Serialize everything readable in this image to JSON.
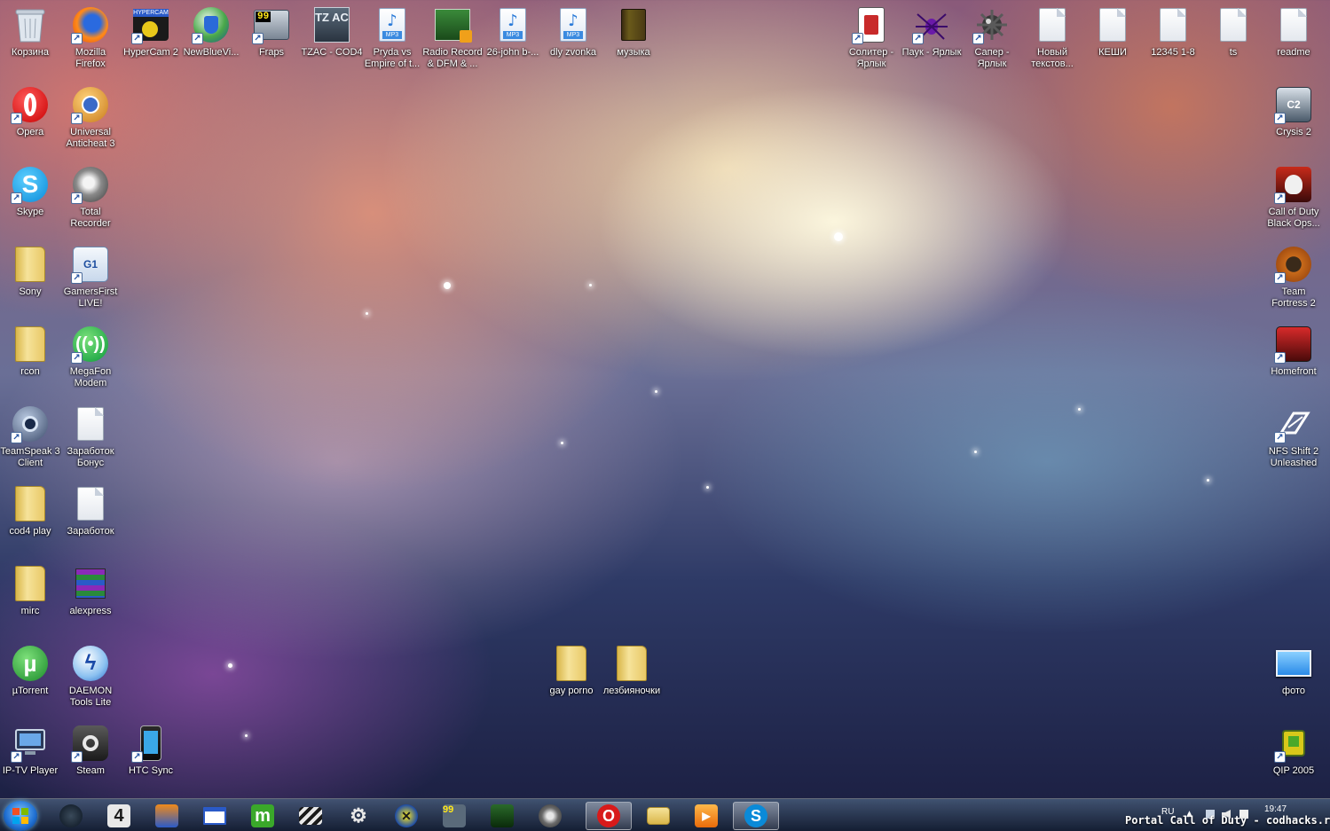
{
  "desktop": {
    "icons": [
      {
        "id": "recycle-bin",
        "label": "Корзина",
        "icon": "recycle-bin-icon"
      },
      {
        "id": "mozilla-firefox",
        "label": "Mozilla Firefox",
        "icon": "firefox-icon"
      },
      {
        "id": "hypercam",
        "label": "HyperCam 2",
        "icon": "hypercam-icon",
        "badge": "HYPERCAM"
      },
      {
        "id": "newbluevi",
        "label": "NewBlueVi...",
        "icon": "newblue-icon"
      },
      {
        "id": "fraps",
        "label": "Fraps",
        "icon": "fraps-icon",
        "badge": "99"
      },
      {
        "id": "tzac",
        "label": "TZAC - COD4",
        "icon": "tzac-icon",
        "badge": "TZ AC"
      },
      {
        "id": "pryda",
        "label": "Pryda vs Empire of t...",
        "icon": "mp3-file-icon",
        "badge": "MP3"
      },
      {
        "id": "radio-record",
        "label": "Radio Record & DFM & ...",
        "icon": "radio-record-icon"
      },
      {
        "id": "26-john",
        "label": "26-john b-...",
        "icon": "mp3-file-icon",
        "badge": "MP3"
      },
      {
        "id": "dly-zvonka",
        "label": "dly zvonka",
        "icon": "mp3-file-icon",
        "badge": "MP3"
      },
      {
        "id": "muzyka",
        "label": "музыка",
        "icon": "book-icon"
      },
      {
        "id": "solitaire",
        "label": "Солитер - Ярлык",
        "icon": "solitaire-icon"
      },
      {
        "id": "spider",
        "label": "Паук - Ярлык",
        "icon": "spider-icon"
      },
      {
        "id": "minesweeper",
        "label": "Сапер - Ярлык",
        "icon": "minesweeper-icon"
      },
      {
        "id": "new-text",
        "label": "Новый текстов...",
        "icon": "text-file-icon"
      },
      {
        "id": "keshi",
        "label": "КЕШИ",
        "icon": "text-file-icon"
      },
      {
        "id": "12345",
        "label": "12345 1-8",
        "icon": "text-file-icon"
      },
      {
        "id": "ts",
        "label": "ts",
        "icon": "text-file-icon"
      },
      {
        "id": "readme",
        "label": "readme",
        "icon": "text-file-icon"
      },
      {
        "id": "opera",
        "label": "Opera",
        "icon": "opera-icon"
      },
      {
        "id": "universal-anticheat",
        "label": "Universal Anticheat 3",
        "icon": "anticheat-icon"
      },
      {
        "id": "crysis2",
        "label": "Crysis 2",
        "icon": "crysis-icon"
      },
      {
        "id": "skype",
        "label": "Skype",
        "icon": "skype-icon"
      },
      {
        "id": "total-recorder",
        "label": "Total Recorder",
        "icon": "speaker-icon"
      },
      {
        "id": "cod-bo",
        "label": "Call of Duty Black Ops...",
        "icon": "black-ops-icon"
      },
      {
        "id": "sony",
        "label": "Sony",
        "icon": "folder-icon"
      },
      {
        "id": "gamersfirst",
        "label": "GamersFirst LIVE!",
        "icon": "gamersfirst-icon"
      },
      {
        "id": "tf2",
        "label": "Team Fortress 2",
        "icon": "tf2-icon"
      },
      {
        "id": "rcon",
        "label": "rcon",
        "icon": "folder-icon"
      },
      {
        "id": "megafon",
        "label": "MegaFon Modem",
        "icon": "megafon-icon"
      },
      {
        "id": "homefront",
        "label": "Homefront",
        "icon": "homefront-icon"
      },
      {
        "id": "teamspeak",
        "label": "TeamSpeak 3 Client",
        "icon": "teamspeak-icon"
      },
      {
        "id": "zarabotok-bonus",
        "label": "Заработок Бонус",
        "icon": "text-file-icon"
      },
      {
        "id": "nfs",
        "label": "NFS Shift 2 Unleashed",
        "icon": "nfs-icon"
      },
      {
        "id": "cod4play",
        "label": "cod4 play",
        "icon": "folder-icon"
      },
      {
        "id": "zarobotok",
        "label": "Заработок",
        "icon": "text-file-icon"
      },
      {
        "id": "mirc",
        "label": "mirc",
        "icon": "folder-icon"
      },
      {
        "id": "alexpress",
        "label": "alexpress",
        "icon": "winrar-icon"
      },
      {
        "id": "gay-porno",
        "label": "gay porno",
        "icon": "folder-icon"
      },
      {
        "id": "lesbi",
        "label": "лезбияночки",
        "icon": "folder-icon"
      },
      {
        "id": "utorrent",
        "label": "µTorrent",
        "icon": "utorrent-icon"
      },
      {
        "id": "daemon",
        "label": "DAEMON Tools Lite",
        "icon": "daemon-tools-icon"
      },
      {
        "id": "foto",
        "label": "фото",
        "icon": "picture-icon"
      },
      {
        "id": "iptv",
        "label": "IP-TV Player",
        "icon": "iptv-icon"
      },
      {
        "id": "steam",
        "label": "Steam",
        "icon": "steam-icon"
      },
      {
        "id": "htc",
        "label": "HTC Sync",
        "icon": "htc-sync-icon"
      },
      {
        "id": "qip",
        "label": "QIP 2005",
        "icon": "qip-icon"
      }
    ]
  },
  "taskbar": {
    "start": {
      "icon": "windows-start-icon"
    },
    "buttons": [
      {
        "id": "tb-media",
        "icon": "media-center-icon"
      },
      {
        "id": "tb-four",
        "icon": "four-icon",
        "text": "4"
      },
      {
        "id": "tb-winamp",
        "icon": "winamp-icon"
      },
      {
        "id": "tb-window",
        "icon": "window-icon"
      },
      {
        "id": "tb-m",
        "icon": "m-app-icon",
        "text": "m"
      },
      {
        "id": "tb-clapper",
        "icon": "clapperboard-icon"
      },
      {
        "id": "tb-gear",
        "icon": "gear-icon"
      },
      {
        "id": "tb-xfire",
        "icon": "xfire-icon"
      },
      {
        "id": "tb-fraps",
        "icon": "fraps-icon",
        "text": "99"
      },
      {
        "id": "tb-anticheat",
        "icon": "anticheat-icon"
      },
      {
        "id": "tb-speaker",
        "icon": "speaker-icon"
      },
      {
        "id": "tb-opera",
        "icon": "opera-icon",
        "text": "O",
        "active": true
      },
      {
        "id": "tb-explorer",
        "icon": "folder-icon"
      },
      {
        "id": "tb-wmp",
        "icon": "media-player-icon"
      },
      {
        "id": "tb-skype",
        "icon": "skype-icon",
        "text": "S",
        "active": true
      }
    ],
    "tray": {
      "language": "RU",
      "time": "19:47"
    }
  },
  "watermark": "Portal Call of Duty - codhacks.ru",
  "colors": {
    "accent": "#1f6fd1",
    "label_text": "#ffffff"
  }
}
